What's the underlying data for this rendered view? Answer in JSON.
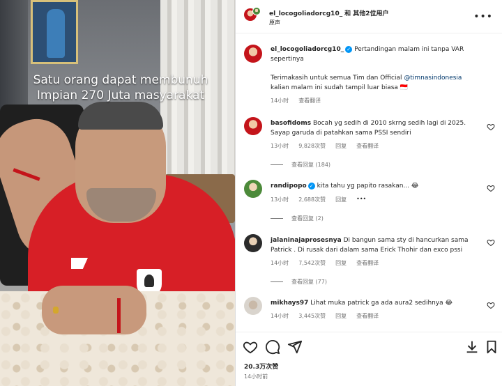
{
  "media": {
    "overlay_line1": "Satu orang dapat membunuh",
    "overlay_line2": "Impian 270 Juta masyarakat"
  },
  "header": {
    "username": "el_locogoliadorcg10_",
    "collab": "和 其他2位用户",
    "subtitle": "原声",
    "more_icon": "more-horizontal-icon"
  },
  "caption": {
    "username": "el_locogoliadorcg10_",
    "text_line1": "Pertandingan malam ini tanpa VAR",
    "text_line2": "sepertinya",
    "text_line3": "Terimakasih untuk semua Tim dan Official",
    "mention": "@timnasindonesia",
    "text_line4": "kalian malam ini sudah tampil luar biasa 🇮🇩",
    "time": "14小时",
    "translate": "查看翻译"
  },
  "comments": [
    {
      "username": "basofidoms",
      "line1": "Bocah yg sedih di 2010 skrng sedih lagi di 2025.",
      "line2": "Sayap garuda di patahkan sama PSSI sendiri",
      "time": "13小时",
      "likes": "9,828次赞",
      "reply": "回复",
      "translate": "查看翻译",
      "view_replies": "查看回复 (184)"
    },
    {
      "username": "randipopo",
      "line1": "kita tahu yg papito rasakan... 😂",
      "time": "13小时",
      "likes": "2,688次赞",
      "reply": "回复",
      "options": "•••",
      "view_replies": "查看回复 (2)"
    },
    {
      "username": "jalaninajaprosesnya",
      "line1": "Di bangun sama sty di hancurkan sama",
      "line2": "Patrick . Di rusak dari dalam sama Erick Thohir dan exco pssi",
      "time": "14小时",
      "likes": "7,542次赞",
      "reply": "回复",
      "translate": "查看翻译",
      "view_replies": "查看回复 (77)"
    },
    {
      "username": "mikhays97",
      "line1": "Lihat muka patrick ga ada aura2 sedihnya 😂",
      "time": "14小时",
      "likes": "3,445次赞",
      "reply": "回复",
      "translate": "查看翻译"
    }
  ],
  "footer": {
    "likes": "20.3万次赞",
    "time": "14小时前"
  },
  "colors": {
    "link": "#00376b",
    "verified": "#0095f6",
    "muted": "#737373",
    "text": "#262626"
  }
}
